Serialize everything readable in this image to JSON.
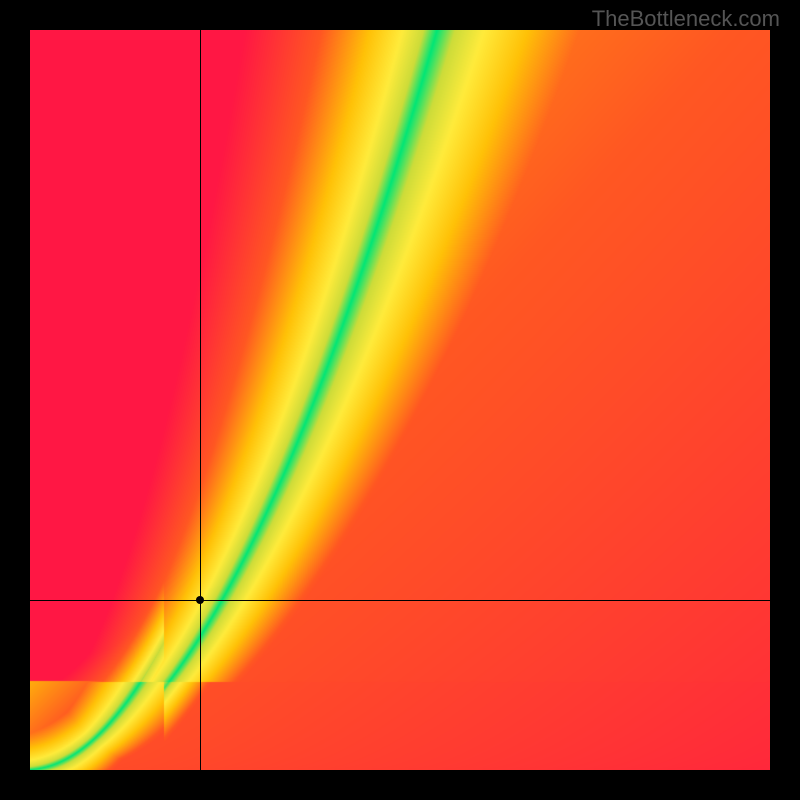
{
  "watermark": "TheBottleneck.com",
  "chart_data": {
    "type": "heatmap",
    "title": "",
    "xlabel": "",
    "ylabel": "",
    "xlim": [
      0,
      1
    ],
    "ylim": [
      0,
      1
    ],
    "crosshair": {
      "x": 0.23,
      "y": 0.23
    },
    "curve_description": "Green optimal band following a superlinear curve from bottom-left toward top-center; heatmap blends from red (far from curve) through orange/yellow to green (on curve).",
    "curve_samples": [
      {
        "x": 0.0,
        "y": 0.0
      },
      {
        "x": 0.05,
        "y": 0.03
      },
      {
        "x": 0.1,
        "y": 0.07
      },
      {
        "x": 0.15,
        "y": 0.12
      },
      {
        "x": 0.2,
        "y": 0.18
      },
      {
        "x": 0.25,
        "y": 0.26
      },
      {
        "x": 0.3,
        "y": 0.36
      },
      {
        "x": 0.35,
        "y": 0.48
      },
      {
        "x": 0.4,
        "y": 0.6
      },
      {
        "x": 0.45,
        "y": 0.73
      },
      {
        "x": 0.5,
        "y": 0.86
      },
      {
        "x": 0.55,
        "y": 1.0
      }
    ],
    "color_stops": [
      {
        "t": 0.0,
        "color": "#ff1744"
      },
      {
        "t": 0.4,
        "color": "#ff5722"
      },
      {
        "t": 0.65,
        "color": "#ffc107"
      },
      {
        "t": 0.82,
        "color": "#ffeb3b"
      },
      {
        "t": 0.93,
        "color": "#cddc39"
      },
      {
        "t": 1.0,
        "color": "#00e676"
      }
    ]
  }
}
